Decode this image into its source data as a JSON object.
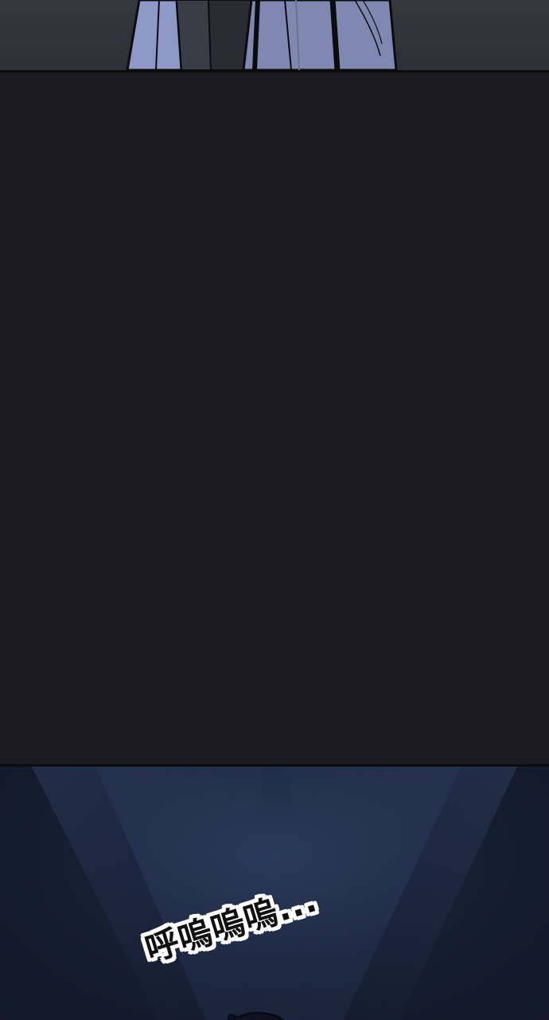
{
  "panels": {
    "top": {
      "description_icon": "figure-legs-icon"
    },
    "middle": {},
    "bottom": {
      "sfx_text": "呼嗚嗚嗚..."
    }
  },
  "colors": {
    "gutter": "#1c1b21",
    "panel_border": "#0c0c0f",
    "top_bg": "#34373d",
    "figure_fabric": "#8f99c8",
    "bottom_glow": "#2a3a5a",
    "bottom_dark": "#141b2c",
    "sfx_fill": "#111114",
    "sfx_outline": "#ffffff"
  }
}
